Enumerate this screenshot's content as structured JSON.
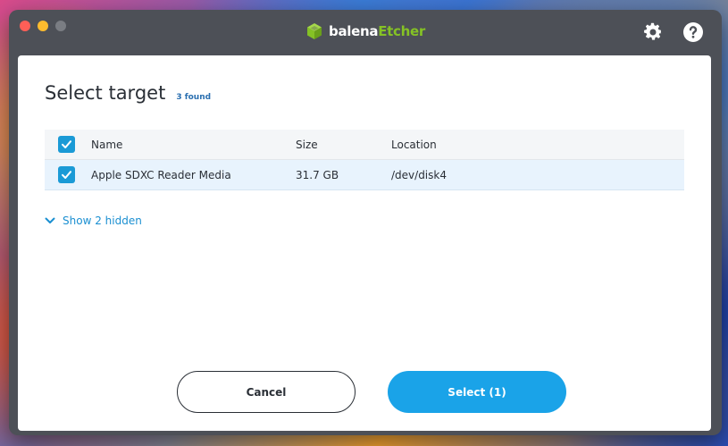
{
  "app": {
    "brand_prefix": "balena",
    "brand_suffix": "Etcher",
    "brand_accent_color": "#85c225"
  },
  "titlebar": {
    "settings_icon": "gear-icon",
    "help_icon": "help-icon"
  },
  "dialog": {
    "title": "Select target",
    "found_count": "3 found",
    "columns": {
      "name": "Name",
      "size": "Size",
      "location": "Location"
    },
    "drives": [
      {
        "name": "Apple SDXC Reader Media",
        "size": "31.7 GB",
        "location": "/dev/disk4",
        "checked": true
      }
    ],
    "show_hidden_label": "Show 2 hidden",
    "cancel_label": "Cancel",
    "select_label": "Select (1)",
    "accent_color": "#1aa3e8"
  }
}
